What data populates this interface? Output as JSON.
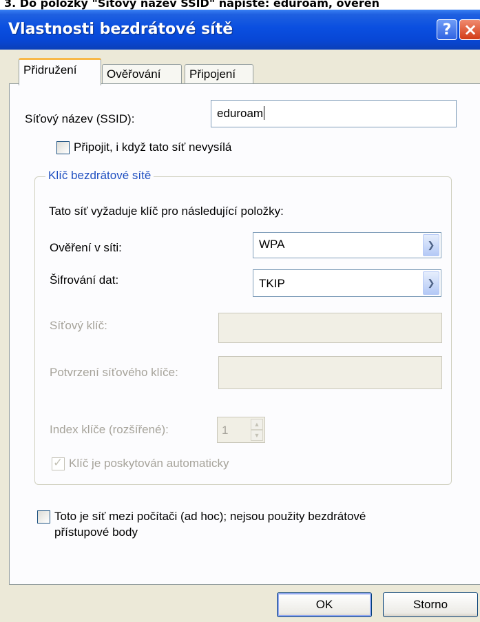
{
  "page_caption": "3. Do položky \"Síťový název SSID\" napište: eduroam, ověřen",
  "window": {
    "title": "Vlastnosti bezdrátové sítě",
    "help_label": "?",
    "close_label": "×"
  },
  "tabs": [
    {
      "label": "Přidružení",
      "active": true
    },
    {
      "label": "Ověřování",
      "active": false
    },
    {
      "label": "Připojení",
      "active": false
    }
  ],
  "ssid": {
    "label": "Síťový název (SSID):",
    "value": "eduroam"
  },
  "connect_even_if_not_broadcasting": {
    "label": "Připojit, i když tato síť nevysílá",
    "checked": false
  },
  "wireless_key_group": {
    "title": "Klíč bezdrátové sítě",
    "description": "Tato síť vyžaduje klíč pro následující položky:",
    "network_auth": {
      "label": "Ověření v síti:",
      "value": "WPA"
    },
    "data_encryption": {
      "label": "Šifrování dat:",
      "value": "TKIP"
    },
    "network_key": {
      "label": "Síťový klíč:",
      "value": ""
    },
    "confirm_key": {
      "label": "Potvrzení síťového klíče:",
      "value": ""
    },
    "key_index": {
      "label": "Index klíče (rozšířené):",
      "value": "1"
    },
    "auto_key": {
      "label": "Klíč je poskytován automaticky",
      "checked": true
    }
  },
  "adhoc": {
    "label_line1": "Toto je síť mezi počítači (ad hoc); nejsou použity bezdrátové",
    "label_line2": "přístupové body",
    "checked": false
  },
  "buttons": {
    "ok": "OK",
    "cancel": "Storno"
  },
  "icons": {
    "dropdown": "chevron-down-icon",
    "spin_up": "spin-up-icon",
    "spin_down": "spin-down-icon",
    "check": "checkmark-icon"
  }
}
